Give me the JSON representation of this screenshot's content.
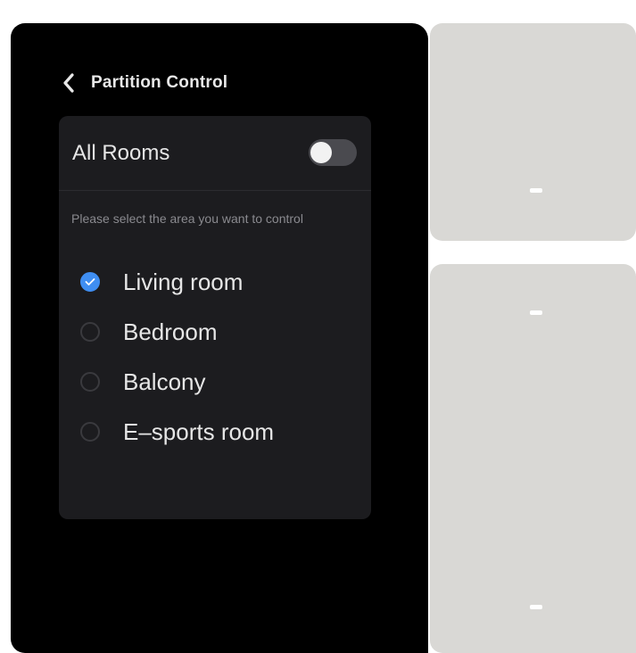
{
  "screen": {
    "title": "Partition Control",
    "back_icon": "chevron-left-icon"
  },
  "card": {
    "all_rooms_label": "All Rooms",
    "all_rooms_toggle": "off",
    "hint": "Please select the area you want to control",
    "options": [
      {
        "label": "Living room",
        "selected": true
      },
      {
        "label": "Bedroom",
        "selected": false
      },
      {
        "label": "Balcony",
        "selected": false
      },
      {
        "label": "E–sports room",
        "selected": false
      }
    ]
  },
  "colors": {
    "accent": "#3f8ef2",
    "screen_bg": "#000000",
    "card_bg": "#1c1c1f",
    "switch_panel": "#d9d8d5"
  }
}
